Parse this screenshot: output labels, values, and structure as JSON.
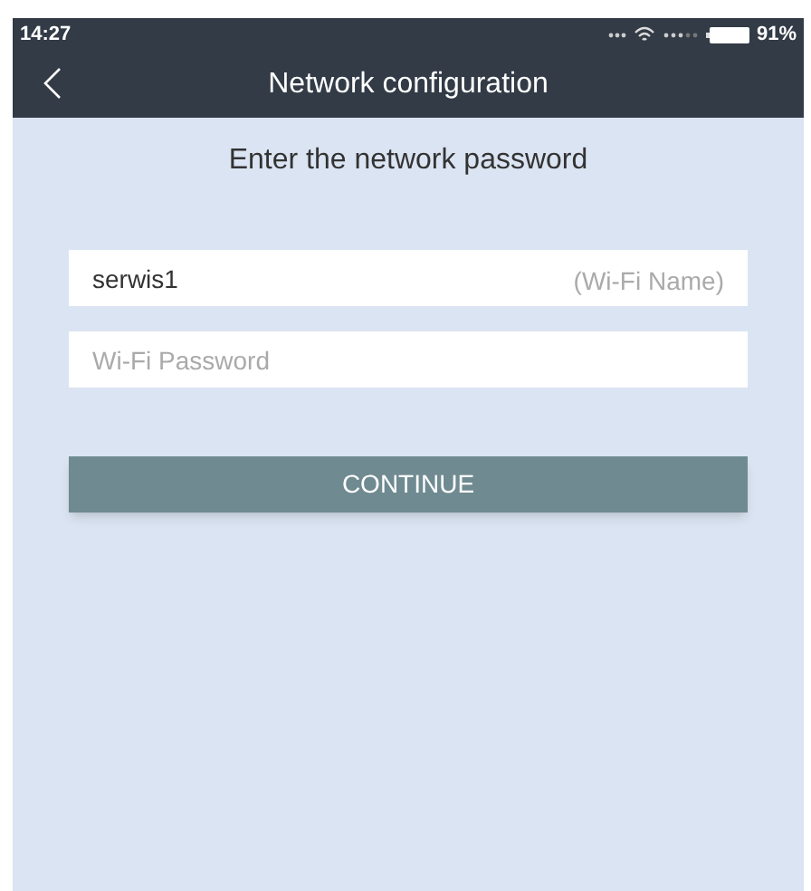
{
  "status_bar": {
    "time": "14:27",
    "battery": "91%"
  },
  "nav": {
    "title": "Network configuration"
  },
  "heading": "Enter the network password",
  "fields": [
    {
      "kind": "name",
      "value": "serwis1",
      "suffix": "(Wi-Fi Name)"
    },
    {
      "kind": "password",
      "placeholder": "Wi-Fi Password"
    }
  ],
  "button": "CONTINUE"
}
